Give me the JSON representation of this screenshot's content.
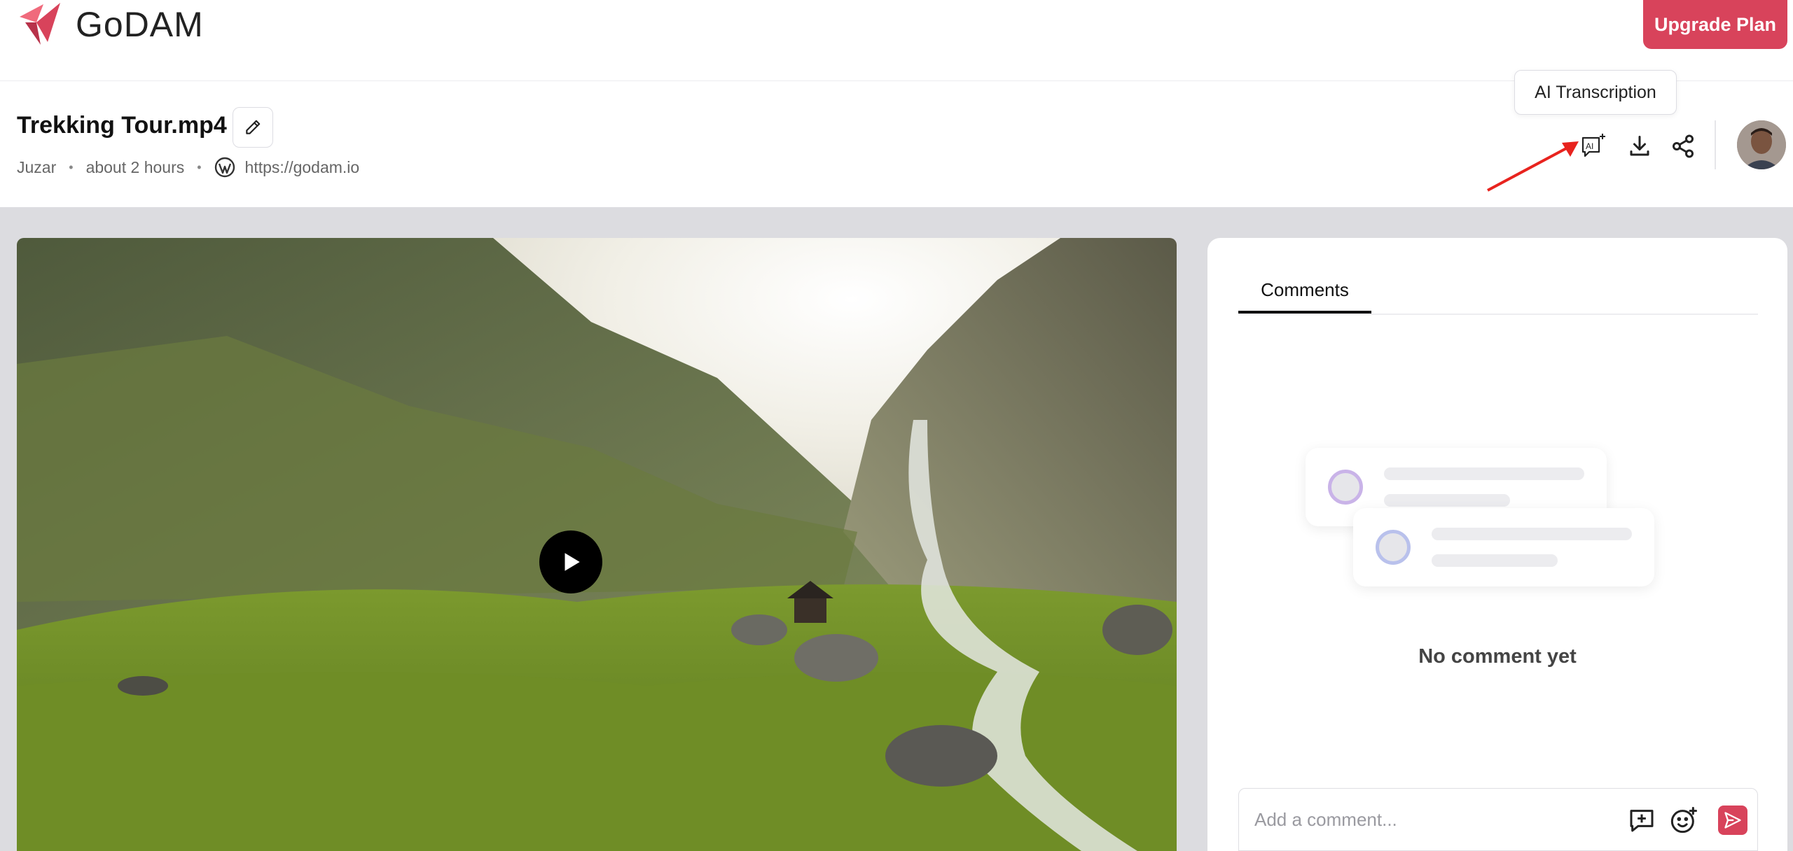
{
  "brand": {
    "name": "GoDAM",
    "accent": "#d8435b"
  },
  "topbar": {
    "upgrade_label": "Upgrade Plan"
  },
  "video": {
    "title": "Trekking Tour.mp4",
    "author": "Juzar",
    "time": "about 2 hours",
    "site_url": "https://godam.io"
  },
  "actions": {
    "tooltip": "AI Transcription",
    "icons": [
      "ai-transcription-icon",
      "download-icon",
      "share-icon"
    ]
  },
  "comments": {
    "tab_label": "Comments",
    "empty_text": "No comment yet",
    "input_placeholder": "Add a comment...",
    "input_value": ""
  },
  "colors": {
    "illustration_ring_1": "#c9b3e8",
    "illustration_ring_2": "#b9c1ec"
  }
}
